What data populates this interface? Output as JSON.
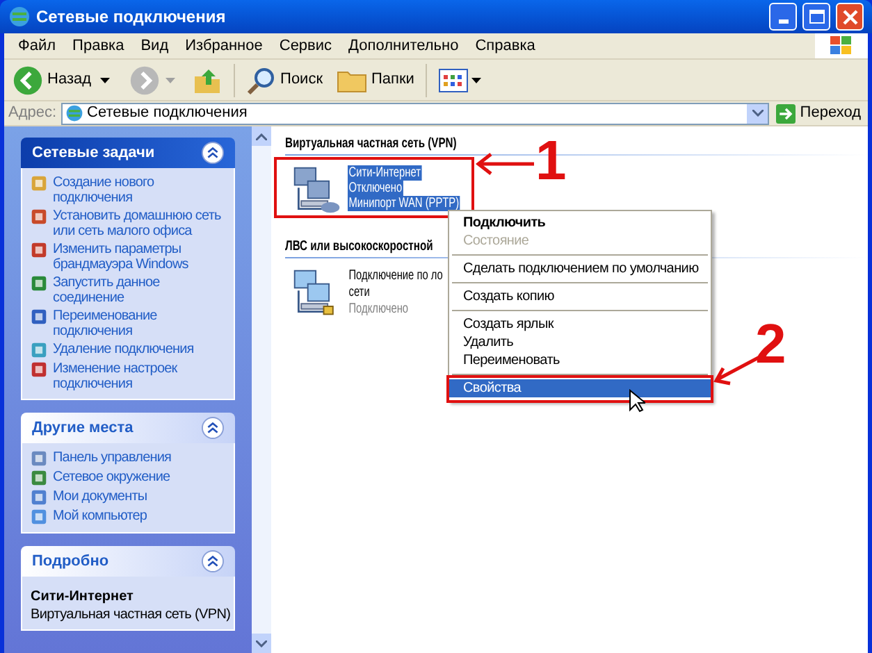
{
  "window": {
    "title": "Сетевые подключения"
  },
  "menu_bar": [
    "Файл",
    "Правка",
    "Вид",
    "Избранное",
    "Сервис",
    "Дополнительно",
    "Справка"
  ],
  "toolbar": {
    "back": "Назад",
    "search": "Поиск",
    "folders": "Папки"
  },
  "address_bar": {
    "label": "Адрес:",
    "value": "Сетевые подключения",
    "go": "Переход"
  },
  "sidebar": {
    "panels": [
      {
        "title": "Сетевые задачи",
        "kind": "special",
        "items": [
          "Создание нового подключения",
          "Установить домашнюю сеть или сеть малого офиса",
          "Изменить параметры брандмауэра Windows",
          "Запустить данное соединение",
          "Переименование подключения",
          "Удаление подключения",
          "Изменение настроек подключения"
        ]
      },
      {
        "title": "Другие места",
        "kind": "normal",
        "items": [
          "Панель управления",
          "Сетевое окружение",
          "Мои документы",
          "Мой компьютер"
        ]
      },
      {
        "title": "Подробно",
        "kind": "details",
        "name": "Сити-Интернет",
        "description": "Виртуальная частная сеть (VPN)"
      }
    ]
  },
  "groups": [
    {
      "title": "Виртуальная частная сеть (VPN)",
      "items": [
        {
          "lines": [
            "Сити-Интернет",
            "Отключено",
            "Минипорт WAN (PPTP)"
          ],
          "selected": true
        }
      ]
    },
    {
      "title": "ЛВС или высокоскоростной",
      "items": [
        {
          "lines": [
            "Подключение по ло",
            "сети"
          ],
          "selected": false,
          "status": "Подключено"
        }
      ]
    }
  ],
  "context_menu": [
    {
      "kind": "item",
      "label": "Подключить",
      "default": true,
      "disabled": false,
      "selected": false
    },
    {
      "kind": "item",
      "label": "Состояние",
      "default": false,
      "disabled": true,
      "selected": false
    },
    {
      "kind": "separator"
    },
    {
      "kind": "item",
      "label": "Сделать подключением по умолчанию",
      "default": false,
      "disabled": false,
      "selected": false
    },
    {
      "kind": "separator"
    },
    {
      "kind": "item",
      "label": "Создать копию",
      "default": false,
      "disabled": false,
      "selected": false
    },
    {
      "kind": "separator"
    },
    {
      "kind": "item",
      "label": "Создать ярлык",
      "default": false,
      "disabled": false,
      "selected": false
    },
    {
      "kind": "item",
      "label": "Удалить",
      "default": false,
      "disabled": false,
      "selected": false
    },
    {
      "kind": "item",
      "label": "Переименовать",
      "default": false,
      "disabled": false,
      "selected": false
    },
    {
      "kind": "separator"
    },
    {
      "kind": "item",
      "label": "Свойства",
      "default": false,
      "disabled": false,
      "selected": true
    }
  ],
  "annotations": [
    {
      "label": "1"
    },
    {
      "label": "2"
    }
  ]
}
